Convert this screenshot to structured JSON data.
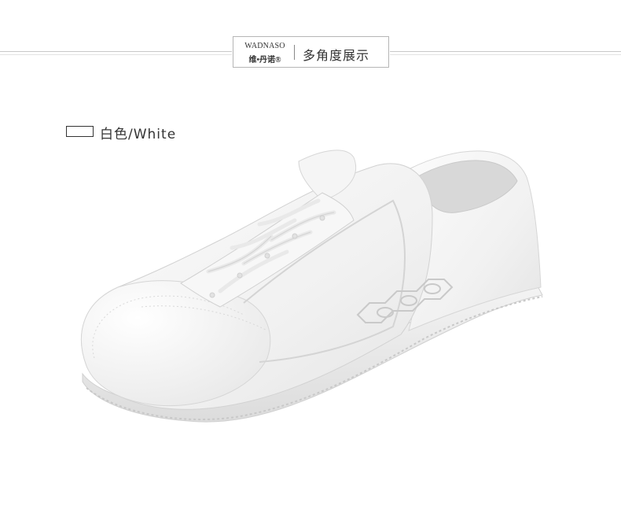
{
  "header": {
    "brand_en": "WADNASO",
    "brand_cn": "维•丹诺®",
    "section_title": "多角度展示"
  },
  "color_option": {
    "label": "白色/White",
    "swatch_color": "#ffffff"
  },
  "product_image": {
    "subject": "shoe-image",
    "main_color": "#f0f0f0"
  }
}
